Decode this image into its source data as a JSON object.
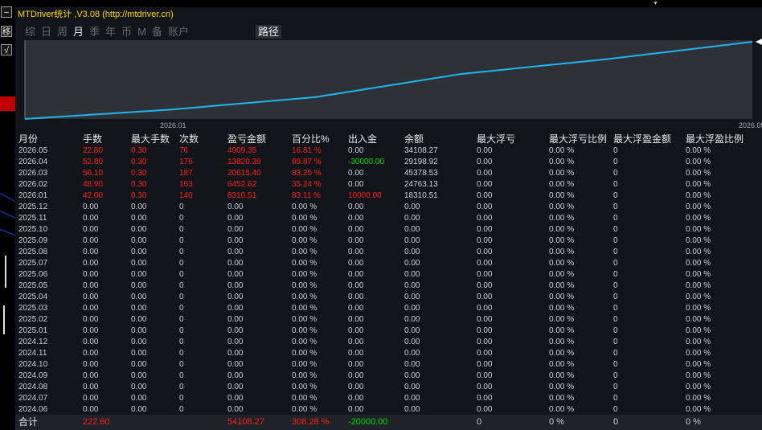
{
  "window": {
    "title": "MTDriver统计 ,V3.08 (http://mtdriver.cn)",
    "strip_buttons": [
      "−",
      "移",
      "√"
    ]
  },
  "tabs": [
    "综",
    "日",
    "周",
    "月",
    "季",
    "年",
    "币",
    "M",
    "备",
    "账户"
  ],
  "active_tab": "月",
  "path_button": "路径",
  "chart_data": {
    "type": "line",
    "x": [
      "2026.01",
      "2026.02",
      "2026.03",
      "2026.04",
      "2026.05"
    ],
    "x_tick_labels": [
      "2026.01",
      "2026.05"
    ],
    "values": [
      18310.51,
      24763.13,
      45378.53,
      29198.92,
      34108.27
    ],
    "line_color": "#1fb6f0",
    "grid": false
  },
  "table": {
    "headers": [
      "月份",
      "手数",
      "最大手数",
      "次数",
      "盈亏金额",
      "百分比%",
      "出入金",
      "余额",
      "最大浮亏",
      "最大浮亏比例",
      "最大浮盈金额",
      "最大浮盈比例"
    ],
    "rows": [
      [
        "2026.05",
        "22.80",
        "0.30",
        "76",
        "4909.35",
        "16.81 %",
        "0.00",
        "34108.27",
        "0.00",
        "0.00 %",
        "0",
        "0.00 %"
      ],
      [
        "2026.04",
        "52.80",
        "0.30",
        "176",
        "13820.39",
        "89.87 %",
        "-30000.00",
        "29198.92",
        "0.00",
        "0.00 %",
        "0",
        "0.00 %"
      ],
      [
        "2026.03",
        "56.10",
        "0.30",
        "187",
        "20615.40",
        "83.25 %",
        "0.00",
        "45378.53",
        "0.00",
        "0.00 %",
        "0",
        "0.00 %"
      ],
      [
        "2026.02",
        "48.90",
        "0.30",
        "163",
        "6452.62",
        "35.24 %",
        "0.00",
        "24763.13",
        "0.00",
        "0.00 %",
        "0",
        "0.00 %"
      ],
      [
        "2026.01",
        "42.00",
        "0.30",
        "140",
        "8310.51",
        "83.11 %",
        "10000.00",
        "18310.51",
        "0.00",
        "0.00 %",
        "0",
        "0.00 %"
      ],
      [
        "2025.12",
        "0.00",
        "0.00",
        "0",
        "0.00",
        "0.00 %",
        "0.00",
        "0.00",
        "0.00",
        "0.00 %",
        "0",
        "0.00 %"
      ],
      [
        "2025.11",
        "0.00",
        "0.00",
        "0",
        "0.00",
        "0.00 %",
        "0.00",
        "0.00",
        "0.00",
        "0.00 %",
        "0",
        "0.00 %"
      ],
      [
        "2025.10",
        "0.00",
        "0.00",
        "0",
        "0.00",
        "0.00 %",
        "0.00",
        "0.00",
        "0.00",
        "0.00 %",
        "0",
        "0.00 %"
      ],
      [
        "2025.09",
        "0.00",
        "0.00",
        "0",
        "0.00",
        "0.00 %",
        "0.00",
        "0.00",
        "0.00",
        "0.00 %",
        "0",
        "0.00 %"
      ],
      [
        "2025.08",
        "0.00",
        "0.00",
        "0",
        "0.00",
        "0.00 %",
        "0.00",
        "0.00",
        "0.00",
        "0.00 %",
        "0",
        "0.00 %"
      ],
      [
        "2025.07",
        "0.00",
        "0.00",
        "0",
        "0.00",
        "0.00 %",
        "0.00",
        "0.00",
        "0.00",
        "0.00 %",
        "0",
        "0.00 %"
      ],
      [
        "2025.06",
        "0.00",
        "0.00",
        "0",
        "0.00",
        "0.00 %",
        "0.00",
        "0.00",
        "0.00",
        "0.00 %",
        "0",
        "0.00 %"
      ],
      [
        "2025.05",
        "0.00",
        "0.00",
        "0",
        "0.00",
        "0.00 %",
        "0.00",
        "0.00",
        "0.00",
        "0.00 %",
        "0",
        "0.00 %"
      ],
      [
        "2025.04",
        "0.00",
        "0.00",
        "0",
        "0.00",
        "0.00 %",
        "0.00",
        "0.00",
        "0.00",
        "0.00 %",
        "0",
        "0.00 %"
      ],
      [
        "2025.03",
        "0.00",
        "0.00",
        "0",
        "0.00",
        "0.00 %",
        "0.00",
        "0.00",
        "0.00",
        "0.00 %",
        "0",
        "0.00 %"
      ],
      [
        "2025.02",
        "0.00",
        "0.00",
        "0",
        "0.00",
        "0.00 %",
        "0.00",
        "0.00",
        "0.00",
        "0.00 %",
        "0",
        "0.00 %"
      ],
      [
        "2025.01",
        "0.00",
        "0.00",
        "0",
        "0.00",
        "0.00 %",
        "0.00",
        "0.00",
        "0.00",
        "0.00 %",
        "0",
        "0.00 %"
      ],
      [
        "2024.12",
        "0.00",
        "0.00",
        "0",
        "0.00",
        "0.00 %",
        "0.00",
        "0.00",
        "0.00",
        "0.00 %",
        "0",
        "0.00 %"
      ],
      [
        "2024.11",
        "0.00",
        "0.00",
        "0",
        "0.00",
        "0.00 %",
        "0.00",
        "0.00",
        "0.00",
        "0.00 %",
        "0",
        "0.00 %"
      ],
      [
        "2024.10",
        "0.00",
        "0.00",
        "0",
        "0.00",
        "0.00 %",
        "0.00",
        "0.00",
        "0.00",
        "0.00 %",
        "0",
        "0.00 %"
      ],
      [
        "2024.09",
        "0.00",
        "0.00",
        "0",
        "0.00",
        "0.00 %",
        "0.00",
        "0.00",
        "0.00",
        "0.00 %",
        "0",
        "0.00 %"
      ],
      [
        "2024.08",
        "0.00",
        "0.00",
        "0",
        "0.00",
        "0.00 %",
        "0.00",
        "0.00",
        "0.00",
        "0.00 %",
        "0",
        "0.00 %"
      ],
      [
        "2024.07",
        "0.00",
        "0.00",
        "0",
        "0.00",
        "0.00 %",
        "0.00",
        "0.00",
        "0.00",
        "0.00 %",
        "0",
        "0.00 %"
      ],
      [
        "2024.06",
        "0.00",
        "0.00",
        "0",
        "0.00",
        "0.00 %",
        "0.00",
        "0.00",
        "0.00",
        "0.00 %",
        "0",
        "0.00 %"
      ]
    ],
    "red_columns": [
      1,
      2,
      3,
      4,
      5
    ],
    "active_month_count": 5
  },
  "totals": {
    "label": "合计",
    "lots": "222.60",
    "profit": "54108.27",
    "percent": "308.28 %",
    "deposit": "-20000.00",
    "max_float_loss": "0",
    "max_float_loss_pct": "0 %",
    "max_float_profit": "0",
    "max_float_profit_pct": "0 %"
  },
  "colors": {
    "profit_red": "#ff2020",
    "deposit_green": "#00e000",
    "title_yellow": "#ffd700",
    "panel_bg": "#111418"
  }
}
